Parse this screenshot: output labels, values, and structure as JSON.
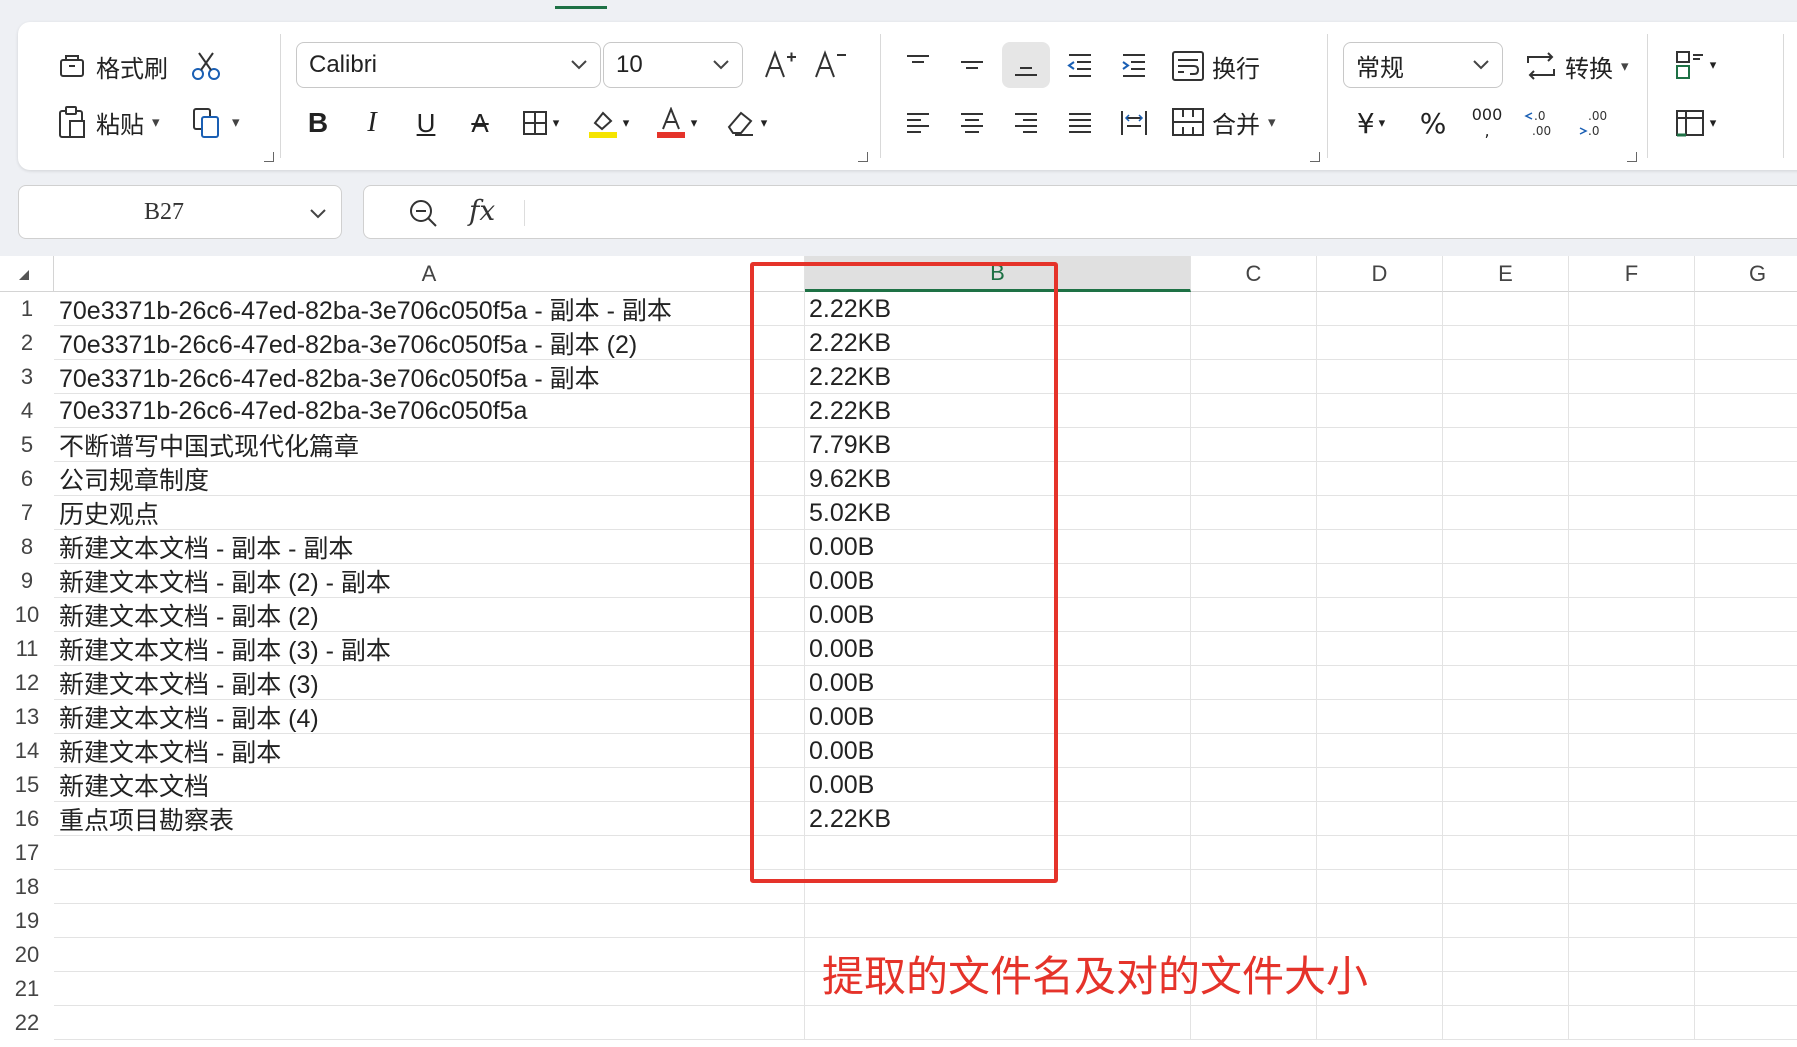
{
  "ribbon": {
    "clipboard": {
      "format_painter": "格式刷",
      "paste": "粘贴"
    },
    "font": {
      "name": "Calibri",
      "size": "10"
    },
    "alignment": {
      "wrap": "换行",
      "merge": "合并"
    },
    "number": {
      "format": "常规",
      "convert": "转换",
      "currency_symbol": "¥",
      "percent_symbol": "%",
      "thousands": "000"
    },
    "colors": {
      "highlight": "#f5e400",
      "font_color": "#e5332a",
      "accent": "#1e7145"
    }
  },
  "formula_bar": {
    "cell_ref": "B27",
    "fx_label": "fx",
    "value": ""
  },
  "sheet": {
    "columns": [
      "A",
      "B",
      "C",
      "D",
      "E",
      "F",
      "G"
    ],
    "selected_column": "B",
    "row_numbers": [
      "1",
      "2",
      "3",
      "4",
      "5",
      "6",
      "7",
      "8",
      "9",
      "10",
      "11",
      "12",
      "13",
      "14",
      "15",
      "16",
      "17",
      "18",
      "19",
      "20",
      "21",
      "22"
    ],
    "rows": [
      {
        "a": "70e3371b-26c6-47ed-82ba-3e706c050f5a - 副本 - 副本",
        "b": "2.22KB"
      },
      {
        "a": "70e3371b-26c6-47ed-82ba-3e706c050f5a - 副本 (2)",
        "b": "2.22KB"
      },
      {
        "a": "70e3371b-26c6-47ed-82ba-3e706c050f5a - 副本",
        "b": "2.22KB"
      },
      {
        "a": "70e3371b-26c6-47ed-82ba-3e706c050f5a",
        "b": "2.22KB"
      },
      {
        "a": "不断谱写中国式现代化篇章",
        "b": "7.79KB"
      },
      {
        "a": "公司规章制度",
        "b": "9.62KB"
      },
      {
        "a": "历史观点",
        "b": "5.02KB"
      },
      {
        "a": "新建文本文档 - 副本 - 副本",
        "b": "0.00B"
      },
      {
        "a": "新建文本文档 - 副本 (2) - 副本",
        "b": "0.00B"
      },
      {
        "a": "新建文本文档 - 副本 (2)",
        "b": "0.00B"
      },
      {
        "a": "新建文本文档 - 副本 (3) - 副本",
        "b": "0.00B"
      },
      {
        "a": "新建文本文档 - 副本 (3)",
        "b": "0.00B"
      },
      {
        "a": "新建文本文档 - 副本 (4)",
        "b": "0.00B"
      },
      {
        "a": "新建文本文档 - 副本",
        "b": "0.00B"
      },
      {
        "a": "新建文本文档",
        "b": "0.00B"
      },
      {
        "a": "重点项目勘察表",
        "b": "2.22KB"
      }
    ]
  },
  "annotation": {
    "text": "提取的文件名及对的文件大小",
    "color": "#e5332a"
  }
}
